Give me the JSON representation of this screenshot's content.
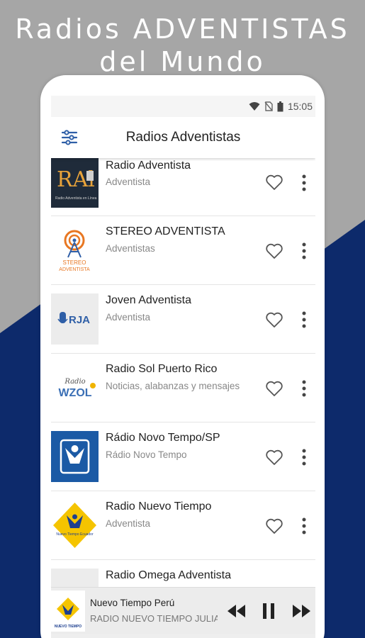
{
  "promo": {
    "line1": "Radios ADVENTISTAS",
    "line2": "del Mundo"
  },
  "colors": {
    "background_gray": "#a6a6a6",
    "background_navy": "#0d2a6b",
    "app_icon_blue": "#2f5fa7"
  },
  "status_bar": {
    "time": "15:05",
    "icons": [
      "wifi-icon",
      "no-sim-icon",
      "battery-icon"
    ]
  },
  "app_bar": {
    "title": "Radios Adventistas",
    "menu_icon": "sliders-icon"
  },
  "stations": [
    {
      "title": "Radio Adventista",
      "subtitle": "Adventista",
      "logo_text": "RAl",
      "logo_caption": "Radio Adventista en Línea"
    },
    {
      "title": "STEREO ADVENTISTA",
      "subtitle": "Adventistas",
      "logo_text": "STEREO",
      "logo_caption": "ADVENTISTA"
    },
    {
      "title": "Joven Adventista",
      "subtitle": "Adventista",
      "logo_text": "RJA"
    },
    {
      "title": "Radio Sol Puerto Rico",
      "subtitle": "Noticias, alabanzas y mensajes",
      "logo_text": "WZOL",
      "logo_caption": "Radio"
    },
    {
      "title": "Rádio Novo Tempo/SP",
      "subtitle": "Rádio Novo Tempo"
    },
    {
      "title": "Radio Nuevo Tiempo",
      "subtitle": "Adventista",
      "logo_text": "Nuevo Tiempo Ecuador"
    },
    {
      "title": "Radio Omega Adventista",
      "subtitle": ""
    }
  ],
  "player": {
    "title": "Nuevo Tiempo Perú",
    "subtitle": "RADIO NUEVO TIEMPO JULIA",
    "logo_caption": "NUEVO TIEMPO",
    "controls": [
      "previous-icon",
      "pause-icon",
      "next-icon"
    ]
  }
}
